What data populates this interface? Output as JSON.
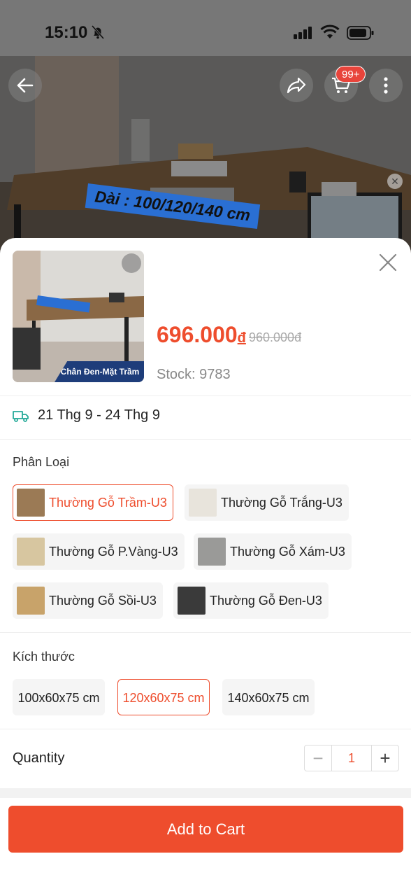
{
  "status_bar": {
    "time": "15:10"
  },
  "header": {
    "cart_badge": "99+",
    "hero_banner_text": "Dài : 100/120/140 cm"
  },
  "product": {
    "price": "696.000",
    "currency": "đ",
    "original_price": "960.000đ",
    "stock_text": "Stock: 9783",
    "thumbnail_caption": "Chân Đen-Mặt Trầm"
  },
  "delivery": {
    "date_range": "21 Thg 9 - 24 Thg 9"
  },
  "variation": {
    "label": "Phân Loại",
    "options": [
      {
        "label": "Thường Gỗ Trầm-U3",
        "selected": true,
        "swatch": "#9b7a55"
      },
      {
        "label": "Thường Gỗ Trắng-U3",
        "selected": false,
        "swatch": "#e8e4dc"
      },
      {
        "label": "Thường Gỗ P.Vàng-U3",
        "selected": false,
        "swatch": "#d7c6a0"
      },
      {
        "label": "Thường Gỗ Xám-U3",
        "selected": false,
        "swatch": "#9a9a98"
      },
      {
        "label": "Thường Gỗ Sồi-U3",
        "selected": false,
        "swatch": "#c8a36a"
      },
      {
        "label": "Thường Gỗ Đen-U3",
        "selected": false,
        "swatch": "#3a3a3a"
      }
    ]
  },
  "size": {
    "label": "Kích thước",
    "options": [
      {
        "label": "100x60x75 cm",
        "selected": false
      },
      {
        "label": "120x60x75 cm",
        "selected": true
      },
      {
        "label": "140x60x75 cm",
        "selected": false
      }
    ]
  },
  "quantity": {
    "label": "Quantity",
    "value": "1",
    "minus": "−",
    "plus": "+"
  },
  "actions": {
    "add_to_cart": "Add to Cart"
  },
  "colors": {
    "accent": "#ee4d2d",
    "badge": "#e8443b"
  }
}
